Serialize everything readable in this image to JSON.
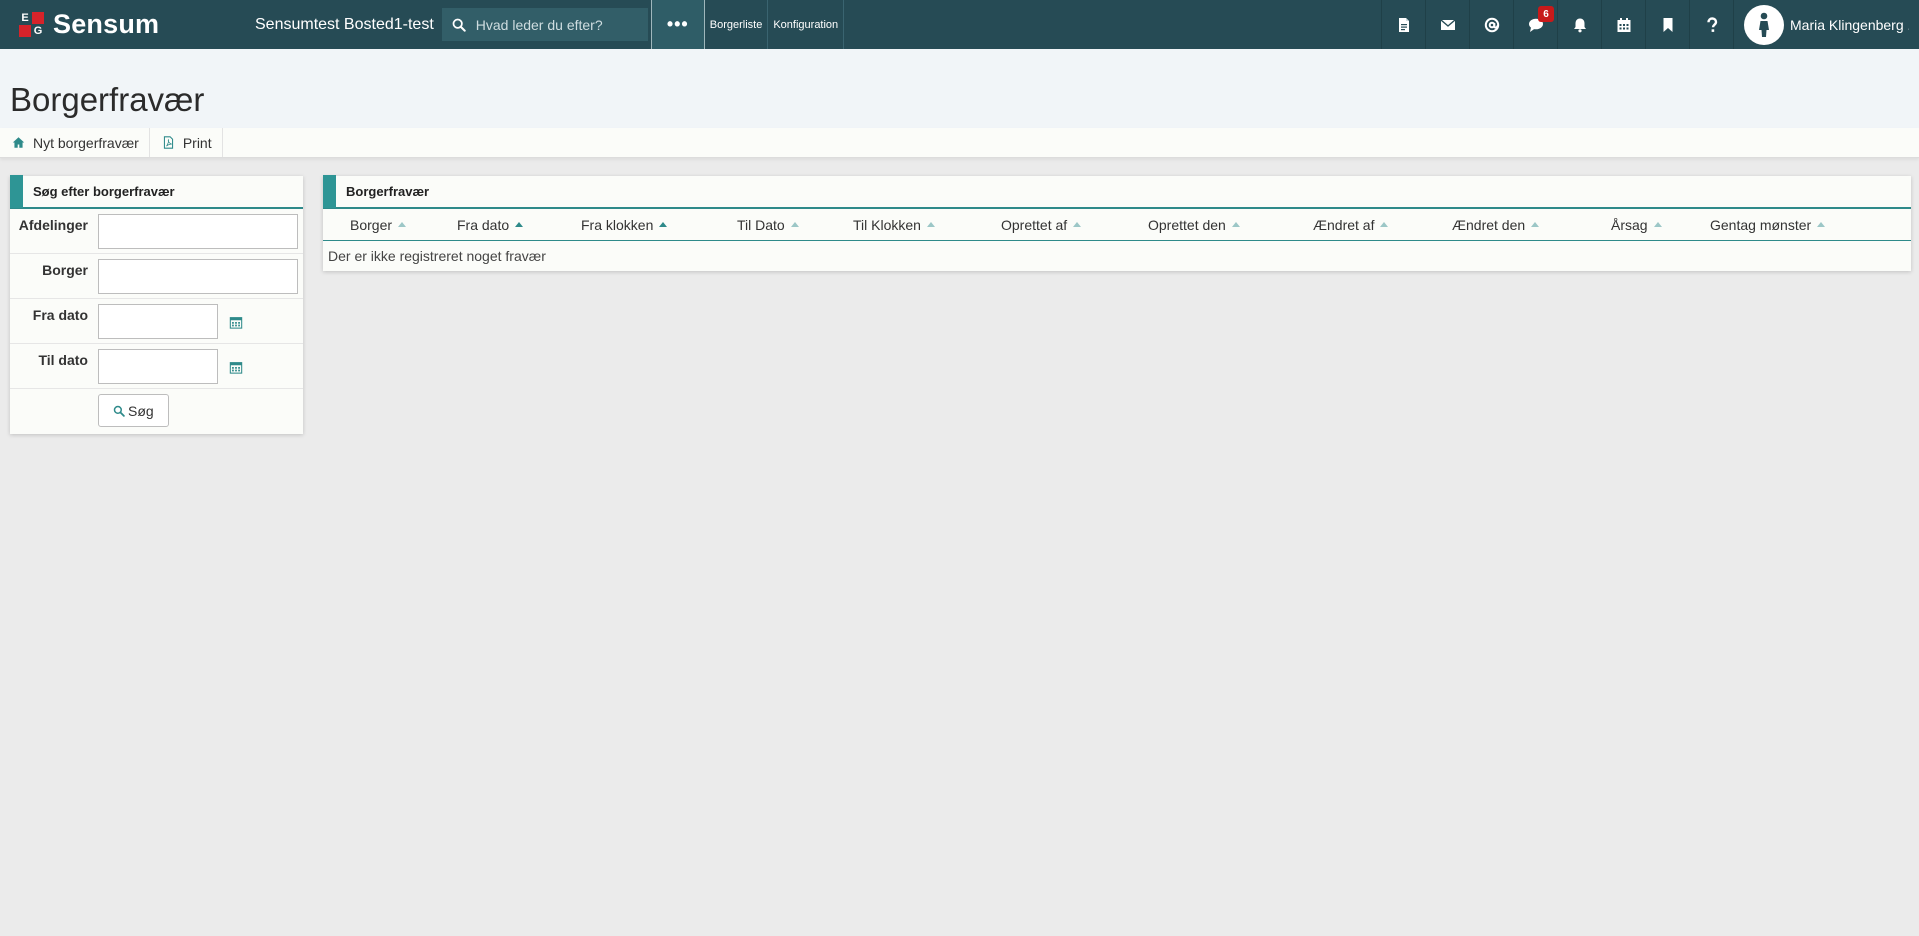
{
  "app": {
    "brand": "Sensum",
    "logo_letters": [
      "E",
      "G"
    ],
    "site": "Sensumtest Bosted1-test"
  },
  "search": {
    "placeholder": "Hvad leder du efter?"
  },
  "nav": {
    "more": "•••",
    "links": [
      "Borgerliste",
      "Konfiguration"
    ]
  },
  "nav_icons": [
    {
      "name": "document-icon"
    },
    {
      "name": "envelope-icon"
    },
    {
      "name": "at-icon"
    },
    {
      "name": "chat-icon",
      "badge": "6"
    },
    {
      "name": "bell-icon"
    },
    {
      "name": "calendar-icon"
    },
    {
      "name": "bookmark-icon"
    },
    {
      "name": "question-icon"
    }
  ],
  "user": {
    "name": "Maria Klingenberg ..."
  },
  "page": {
    "title": "Borgerfravær"
  },
  "toolbar": {
    "new_label": "Nyt borgerfravær",
    "print_label": "Print"
  },
  "search_panel": {
    "title": "Søg efter borgerfravær",
    "fields": {
      "afdelinger": "Afdelinger",
      "borger": "Borger",
      "fra_dato": "Fra dato",
      "til_dato": "Til dato"
    },
    "submit_label": "Søg"
  },
  "table_panel": {
    "title": "Borgerfravær",
    "columns": [
      "Borger",
      "Fra dato",
      "Fra klokken",
      "Til Dato",
      "Til Klokken",
      "Oprettet af",
      "Oprettet den",
      "Ændret af",
      "Ændret den",
      "Årsag",
      "Gentag mønster"
    ],
    "empty_message": "Der er ikke registreret noget fravær"
  },
  "colors": {
    "navbar": "#264b55",
    "accent": "#2e9595",
    "badge": "#c71a1a"
  }
}
